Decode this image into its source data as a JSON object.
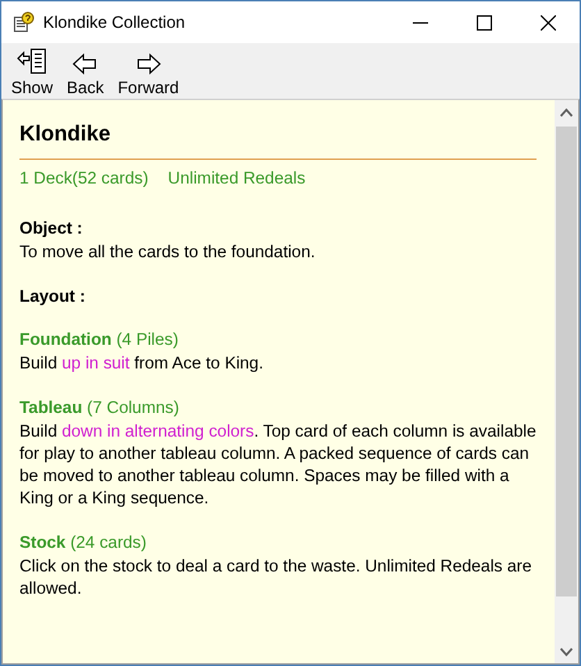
{
  "window": {
    "title": "Klondike Collection"
  },
  "toolbar": {
    "buttons": [
      {
        "kind": "show",
        "label": "Show"
      },
      {
        "kind": "back",
        "label": "Back"
      },
      {
        "kind": "forward",
        "label": "Forward"
      }
    ]
  },
  "content": {
    "title": "Klondike",
    "summary": [
      "1 Deck(52 cards)",
      "Unlimited Redeals"
    ],
    "blocks": [
      {
        "kind": "label",
        "heading": "Object :",
        "body": [
          {
            "text": "To move all the cards to the foundation.",
            "highlight": false
          }
        ]
      },
      {
        "kind": "label",
        "heading": "Layout :"
      },
      {
        "kind": "pile",
        "heading": "**Foundation** (4 Piles)",
        "body": [
          {
            "text": "Build ",
            "highlight": false
          },
          {
            "text": "up in suit",
            "highlight": true
          },
          {
            "text": " from Ace to King.",
            "highlight": false
          }
        ]
      },
      {
        "kind": "pile",
        "heading": "**Tableau** (7 Columns)",
        "body": [
          {
            "text": "Build ",
            "highlight": false
          },
          {
            "text": "down in alternating colors",
            "highlight": true
          },
          {
            "text": ". Top card of each column is available for play to another tableau column. A packed sequence of cards can be moved to another tableau column. Spaces may be filled with a King or a King sequence.",
            "highlight": false
          }
        ]
      },
      {
        "kind": "pile",
        "heading": "**Stock** (24 cards)",
        "body": [
          {
            "text": "Click on the stock to deal a card to the waste. Unlimited Redeals are allowed.",
            "highlight": false
          }
        ]
      }
    ]
  }
}
